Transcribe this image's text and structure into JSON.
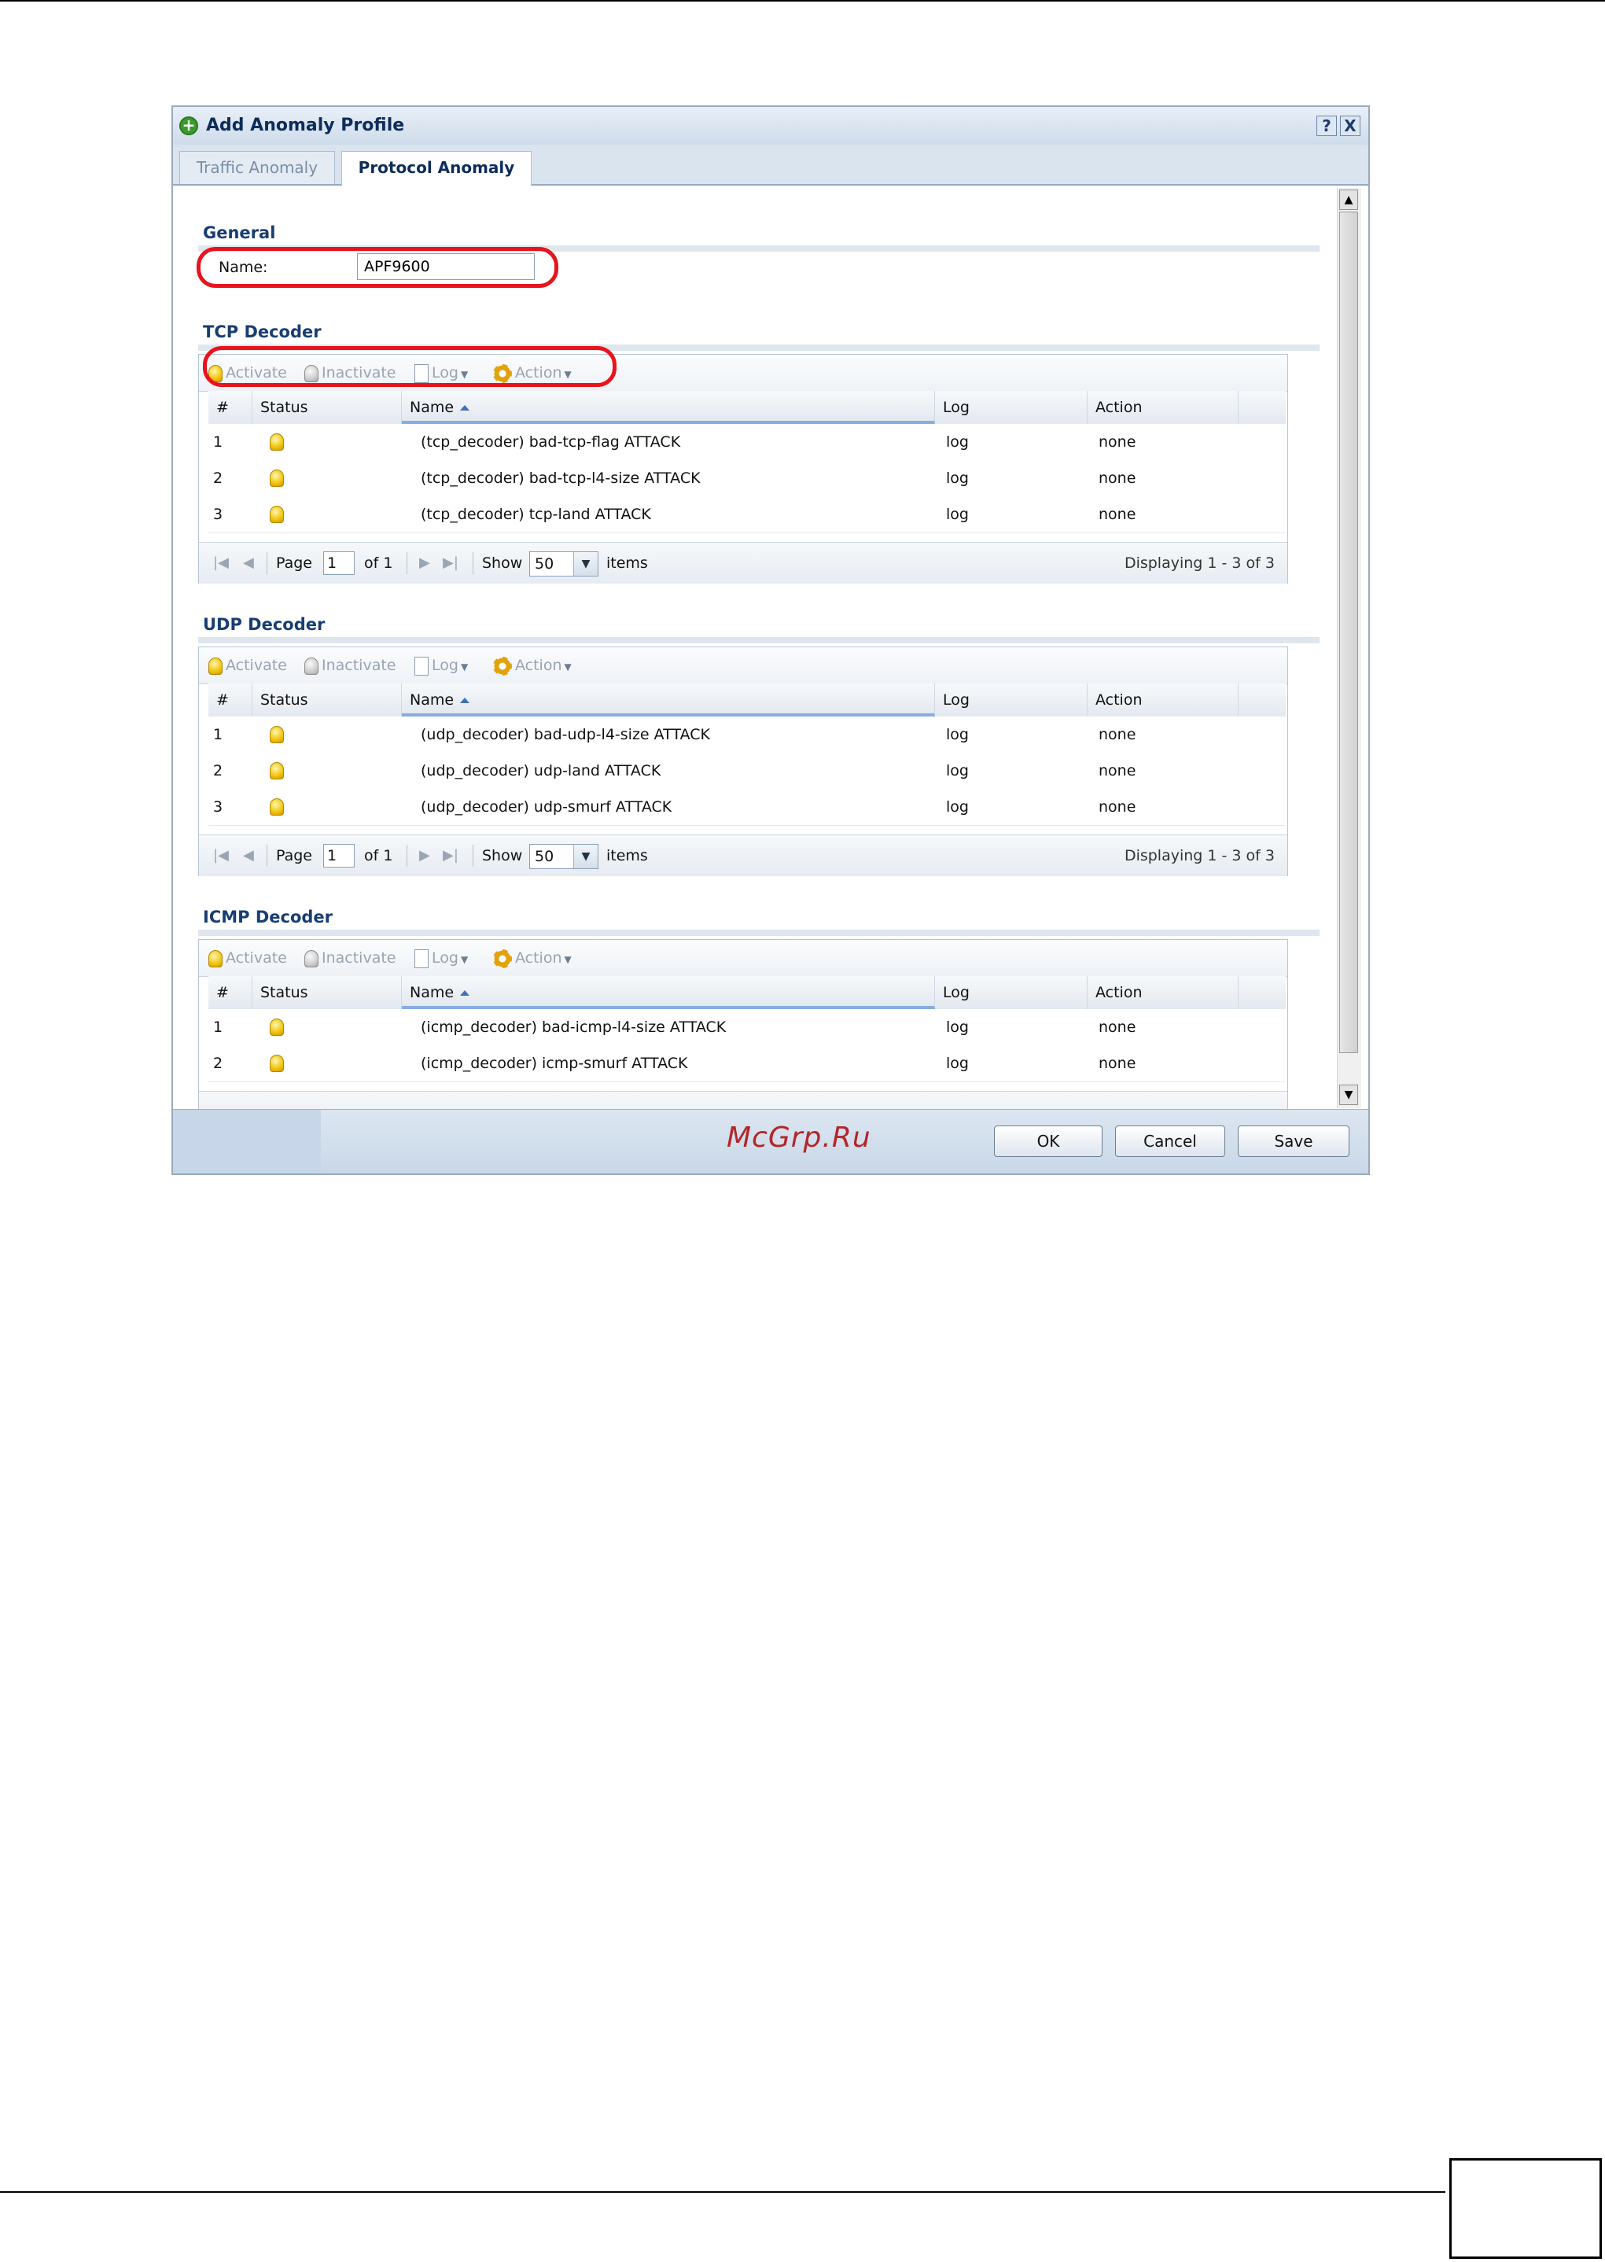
{
  "dialog": {
    "title": "Add Anomaly Profile",
    "help_label": "?",
    "close_label": "X"
  },
  "tabs": [
    {
      "label": "Traffic Anomaly",
      "active": false
    },
    {
      "label": "Protocol Anomaly",
      "active": true
    }
  ],
  "general": {
    "heading": "General",
    "name_label": "Name:",
    "name_value": "APF9600"
  },
  "toolbar": {
    "activate": "Activate",
    "inactivate": "Inactivate",
    "log": "Log",
    "action": "Action"
  },
  "columns": {
    "num": "#",
    "status": "Status",
    "name": "Name",
    "log": "Log",
    "action": "Action"
  },
  "pager": {
    "page_label": "Page",
    "page_value": "1",
    "of_label": "of 1",
    "show_label": "Show",
    "show_value": "50",
    "items_label": "items"
  },
  "sections": [
    {
      "heading": "TCP Decoder",
      "display": "Displaying 1 - 3 of 3",
      "rows": [
        {
          "num": "1",
          "name": "(tcp_decoder) bad-tcp-flag ATTACK",
          "log": "log",
          "action": "none"
        },
        {
          "num": "2",
          "name": "(tcp_decoder) bad-tcp-l4-size ATTACK",
          "log": "log",
          "action": "none"
        },
        {
          "num": "3",
          "name": "(tcp_decoder) tcp-land ATTACK",
          "log": "log",
          "action": "none"
        }
      ]
    },
    {
      "heading": "UDP Decoder",
      "display": "Displaying 1 - 3 of 3",
      "rows": [
        {
          "num": "1",
          "name": "(udp_decoder) bad-udp-l4-size ATTACK",
          "log": "log",
          "action": "none"
        },
        {
          "num": "2",
          "name": "(udp_decoder) udp-land ATTACK",
          "log": "log",
          "action": "none"
        },
        {
          "num": "3",
          "name": "(udp_decoder) udp-smurf ATTACK",
          "log": "log",
          "action": "none"
        }
      ]
    },
    {
      "heading": "ICMP Decoder",
      "rows": [
        {
          "num": "1",
          "name": "(icmp_decoder) bad-icmp-l4-size ATTACK",
          "log": "log",
          "action": "none"
        },
        {
          "num": "2",
          "name": "(icmp_decoder) icmp-smurf ATTACK",
          "log": "log",
          "action": "none"
        }
      ]
    }
  ],
  "footer": {
    "watermark": "McGrp.Ru",
    "ok": "OK",
    "cancel": "Cancel",
    "save": "Save"
  },
  "colors": {
    "highlight": "#e8141d",
    "section_heading": "#183e72",
    "status_on": "#f1c30a"
  },
  "icons": [
    "add-icon",
    "help-icon",
    "close-icon",
    "bulb-on-icon",
    "bulb-off-icon",
    "document-icon",
    "gear-icon",
    "sort-asc-icon"
  ]
}
